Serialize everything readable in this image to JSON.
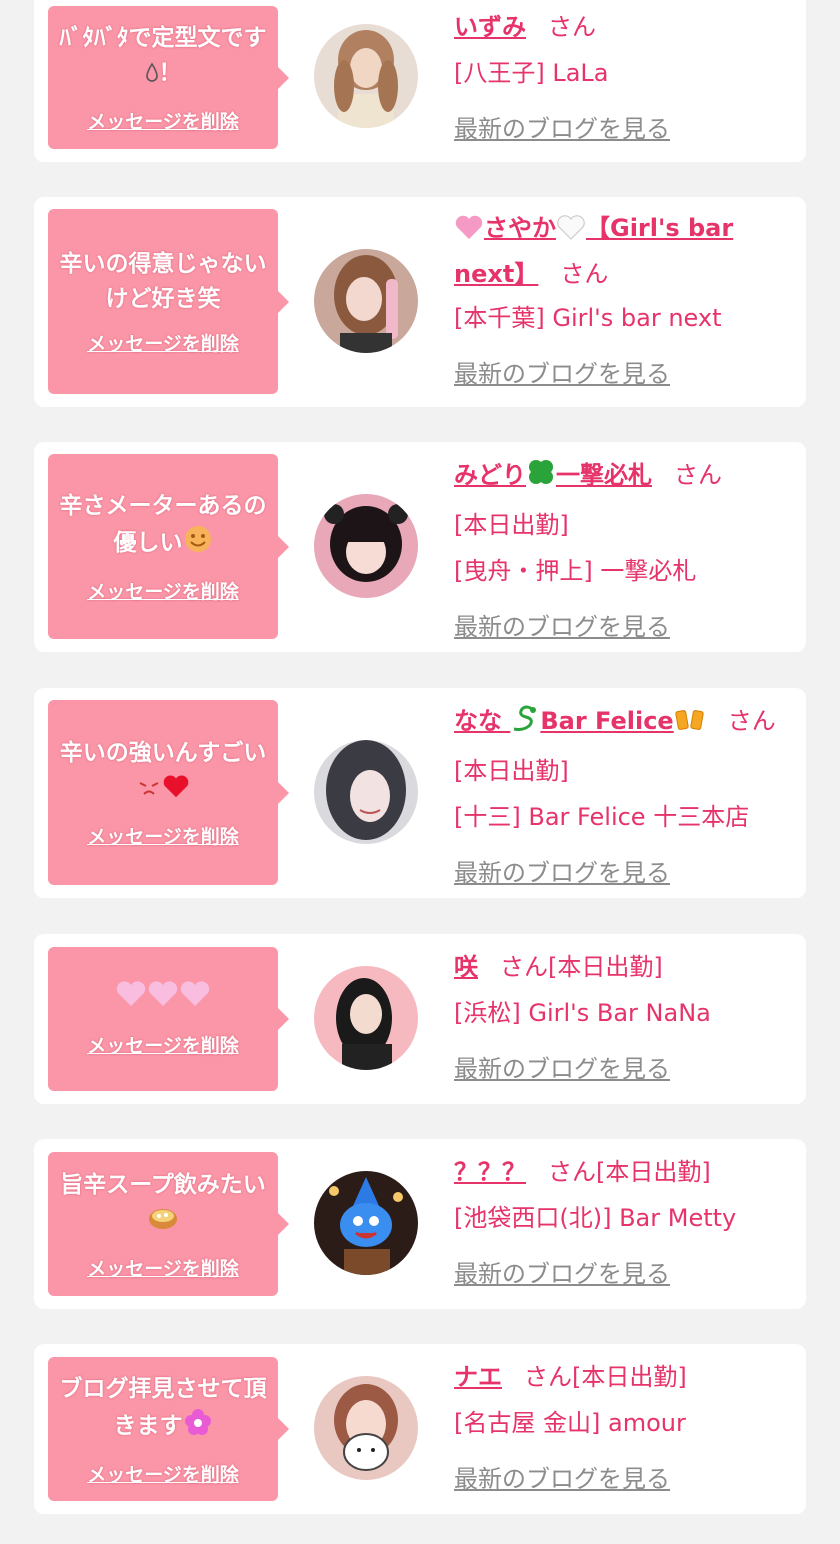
{
  "labels": {
    "delete": "メッセージを削除",
    "blog": "最新のブログを見る",
    "san": "さん"
  },
  "colors": {
    "accent": "#e6336a",
    "bubble": "#fa96a7",
    "link_gray": "#8c8c8c",
    "background": "#f2f2f2"
  },
  "cards": [
    {
      "message_a": "ﾊﾞﾀﾊﾞﾀで定型文です",
      "message_b": "！",
      "name": "いずみ",
      "area": "[八王子] LaLa",
      "today": ""
    },
    {
      "message_a": "辛いの得意じゃないけど好き笑",
      "message_b": "",
      "name_a": "さやか",
      "name_b": "【Girl's bar next】",
      "area": "[本千葉] Girl's bar next",
      "today": ""
    },
    {
      "message_a": "辛さメーターあるの優しい",
      "message_b": "",
      "name_a": "みどり",
      "name_b": "一撃必札",
      "today": "[本日出勤]",
      "area": "[曳舟・押上] 一撃必札"
    },
    {
      "message_a": "辛いの強いんすごい",
      "message_b": "",
      "name_a": "なな ",
      "name_b": "Bar Felice",
      "today": "[本日出勤]",
      "area": "[十三] Bar Felice 十三本店"
    },
    {
      "message_a": "",
      "message_b": "",
      "name": "咲",
      "today": "[本日出勤]",
      "area": "[浜松] Girl's Bar NaNa"
    },
    {
      "message_a": "旨辛スープ飲みたい",
      "message_b": "",
      "name": "？？？",
      "today": "[本日出勤]",
      "area": "[池袋西口(北)] Bar Metty"
    },
    {
      "message_a": "ブログ拝見させて頂きます",
      "message_b": "",
      "name": "ナエ",
      "today": "[本日出勤]",
      "area": "[名古屋 金山] amour"
    }
  ],
  "icons": [
    "drop-icon",
    "pink-heart-icon",
    "white-heart-icon",
    "clover-icon",
    "smile-icon",
    "snake-icon",
    "cheers-icon",
    "pout-icon",
    "red-heart-icon",
    "soup-icon",
    "flower-icon"
  ]
}
